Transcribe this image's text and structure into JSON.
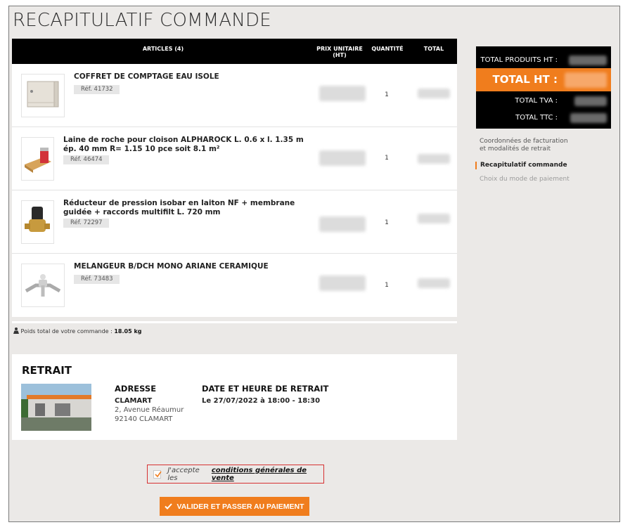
{
  "page": {
    "title": "RECAPITULATIF COMMANDE"
  },
  "cart": {
    "headers": {
      "articles": "ARTICLES (4)",
      "prix": "PRIX UNITAIRE (HT)",
      "quantite": "QUANTITÉ",
      "total": "TOTAL"
    },
    "items": [
      {
        "name": "COFFRET DE COMPTAGE EAU ISOLE",
        "ref": "Réf. 41732",
        "qty": "1",
        "icon": "meter-box-image"
      },
      {
        "name": "Laine de roche pour cloison ALPHAROCK L. 0.6 x l. 1.35 m ép. 40 mm R= 1.15 10 pce soit 8.1 m²",
        "ref": "Réf. 46474",
        "qty": "1",
        "icon": "rockwool-image"
      },
      {
        "name": "Réducteur de pression isobar en laiton NF + membrane guidée + raccords multifilt L. 720 mm",
        "ref": "Réf. 72297",
        "qty": "1",
        "icon": "pressure-reducer-image"
      },
      {
        "name": "MELANGEUR B/DCH MONO ARIANE CERAMIQUE",
        "ref": "Réf. 73483",
        "qty": "1",
        "icon": "mixer-tap-image"
      }
    ],
    "weight_label": "Poids total de votre commande :",
    "weight_value": "18.05 kg"
  },
  "retrait": {
    "title": "RETRAIT",
    "address_heading": "ADRESSE",
    "address_city": "CLAMART",
    "address_line1": "2, Avenue Réaumur",
    "address_line2": "92140 CLAMART",
    "date_heading": "DATE ET HEURE DE RETRAIT",
    "date_value": "Le 27/07/2022 à 18:00 - 18:30"
  },
  "cgv": {
    "prefix": "J'accepte les",
    "link": "conditions générales de vente",
    "checked": true
  },
  "actions": {
    "pay_label": "VALIDER ET PASSER AU PAIEMENT"
  },
  "totals": {
    "products_label": "TOTAL PRODUITS HT :",
    "ht_label": "TOTAL HT :",
    "tva_label": "TOTAL TVA :",
    "ttc_label": "TOTAL TTC :"
  },
  "steps": [
    {
      "label": "Coordonnées de facturation et modalités de retrait",
      "state": "done"
    },
    {
      "label": "Recapitulatif commande",
      "state": "active"
    },
    {
      "label": "Choix du mode de paiement",
      "state": "disabled"
    }
  ],
  "colors": {
    "accent": "#f07d1d",
    "header_bg": "#000000",
    "page_bg": "#ebe9e7",
    "cgv_border": "#d63031"
  }
}
